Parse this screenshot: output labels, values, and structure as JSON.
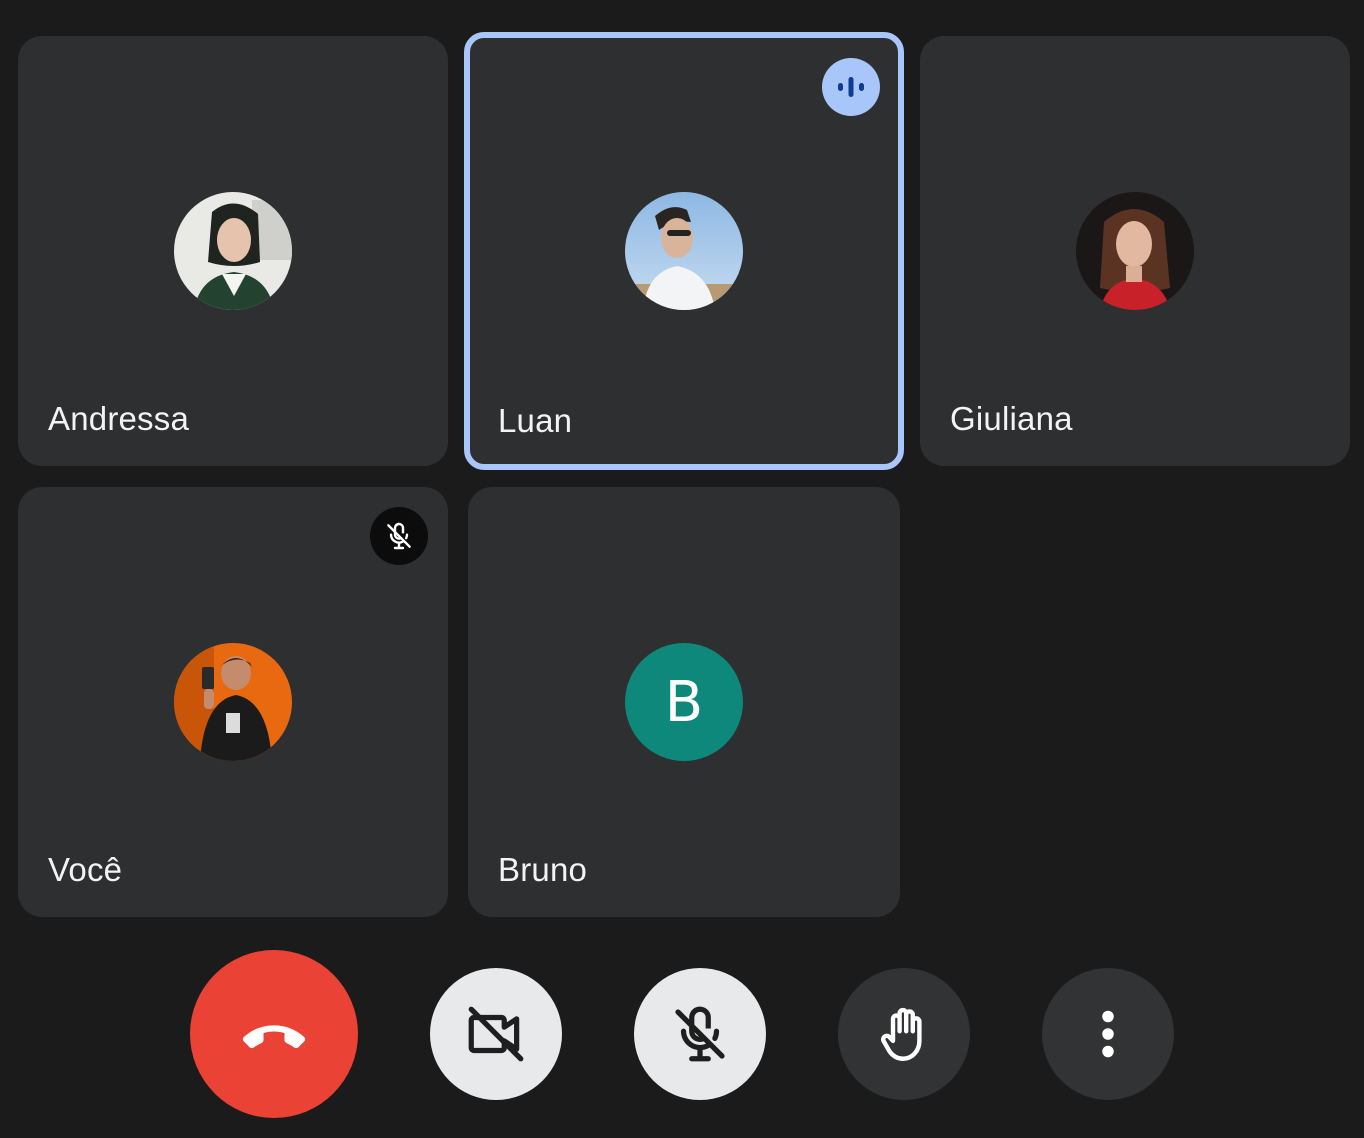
{
  "participants": [
    {
      "name": "Andressa"
    },
    {
      "name": "Luan",
      "speaking": true
    },
    {
      "name": "Giuliana"
    },
    {
      "name": "Você",
      "muted": true
    },
    {
      "name": "Bruno",
      "initial": "B"
    }
  ],
  "colors": {
    "background": "#1b1b1c",
    "tile": "#2e2f30",
    "speaking_border": "#a8c6fa",
    "end_call": "#ea4335",
    "bruno_avatar": "#0e887b"
  },
  "controls": [
    {
      "icon": "end-call-icon"
    },
    {
      "icon": "camera-off-icon"
    },
    {
      "icon": "mic-off-icon"
    },
    {
      "icon": "raise-hand-icon"
    },
    {
      "icon": "more-vert-icon"
    }
  ]
}
